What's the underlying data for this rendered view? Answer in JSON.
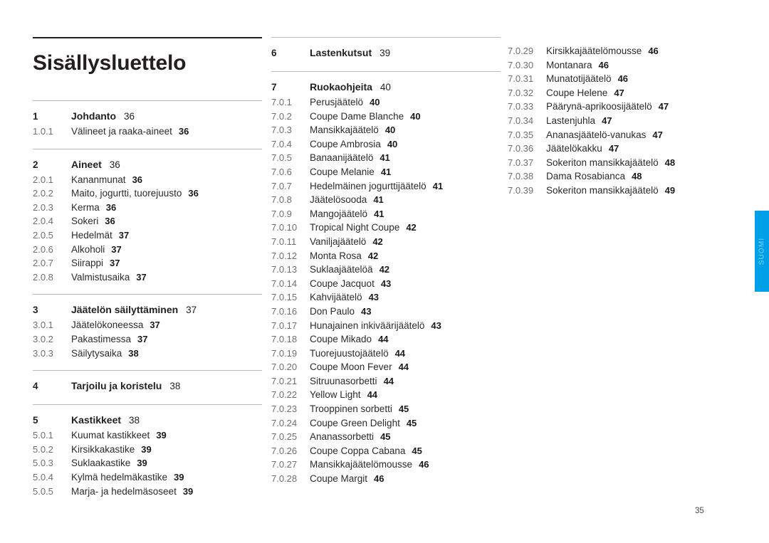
{
  "title": "Sisällysluettelo",
  "side_tab": {
    "label": "SUOMI",
    "color": "#00a0e9",
    "text_color": "#7fd2f6"
  },
  "folio": "35",
  "columns": [
    {
      "groups": [
        {
          "rule": "thick",
          "is_title_block": true,
          "entries": []
        },
        {
          "rule": "thin",
          "entries": [
            {
              "num": "1",
              "title": "Johdanto",
              "page": "36",
              "head": true
            },
            {
              "num": "1.0.1",
              "title": "Välineet ja raaka-aineet",
              "page": "36",
              "head": false
            }
          ]
        },
        {
          "rule": "thin",
          "entries": [
            {
              "num": "2",
              "title": "Aineet",
              "page": "36",
              "head": true
            },
            {
              "num": "2.0.1",
              "title": "Kananmunat",
              "page": "36",
              "head": false
            },
            {
              "num": "2.0.2",
              "title": "Maito, jogurtti, tuorejuusto",
              "page": "36",
              "head": false
            },
            {
              "num": "2.0.3",
              "title": "Kerma",
              "page": "36",
              "head": false
            },
            {
              "num": "2.0.4",
              "title": "Sokeri",
              "page": "36",
              "head": false
            },
            {
              "num": "2.0.5",
              "title": "Hedelmät",
              "page": "37",
              "head": false
            },
            {
              "num": "2.0.6",
              "title": "Alkoholi",
              "page": "37",
              "head": false
            },
            {
              "num": "2.0.7",
              "title": "Siirappi",
              "page": "37",
              "head": false
            },
            {
              "num": "2.0.8",
              "title": "Valmistusaika",
              "page": "37",
              "head": false
            }
          ]
        },
        {
          "rule": "thin",
          "entries": [
            {
              "num": "3",
              "title": "Jäätelön säilyttäminen",
              "page": "37",
              "head": true
            },
            {
              "num": "3.0.1",
              "title": "Jäätelökoneessa",
              "page": "37",
              "head": false
            },
            {
              "num": "3.0.2",
              "title": "Pakastimessa",
              "page": "37",
              "head": false
            },
            {
              "num": "3.0.3",
              "title": "Säilytysaika",
              "page": "38",
              "head": false
            }
          ]
        },
        {
          "rule": "thin",
          "entries": [
            {
              "num": "4",
              "title": "Tarjoilu ja koristelu",
              "page": "38",
              "head": true
            }
          ]
        },
        {
          "rule": "thin",
          "entries": [
            {
              "num": "5",
              "title": "Kastikkeet",
              "page": "38",
              "head": true
            },
            {
              "num": "5.0.1",
              "title": "Kuumat kastikkeet",
              "page": "39",
              "head": false
            },
            {
              "num": "5.0.2",
              "title": "Kirsikkakastike",
              "page": "39",
              "head": false
            },
            {
              "num": "5.0.3",
              "title": "Suklaakastike",
              "page": "39",
              "head": false
            },
            {
              "num": "5.0.4",
              "title": "Kylmä hedelmäkastike",
              "page": "39",
              "head": false
            },
            {
              "num": "5.0.5",
              "title": "Marja- ja hedelmäsoseet",
              "page": "39",
              "head": false
            }
          ]
        }
      ]
    },
    {
      "groups": [
        {
          "rule": "thin",
          "entries": [
            {
              "num": "6",
              "title": "Lastenkutsut",
              "page": "39",
              "head": true
            }
          ]
        },
        {
          "rule": "thin",
          "entries": [
            {
              "num": "7",
              "title": "Ruokaohjeita",
              "page": "40",
              "head": true
            },
            {
              "num": "7.0.1",
              "title": "Perusjäätelö",
              "page": "40",
              "head": false
            },
            {
              "num": "7.0.2",
              "title": "Coupe Dame Blanche",
              "page": "40",
              "head": false
            },
            {
              "num": "7.0.3",
              "title": "Mansikkajäätelö",
              "page": "40",
              "head": false
            },
            {
              "num": "7.0.4",
              "title": "Coupe Ambrosia",
              "page": "40",
              "head": false
            },
            {
              "num": "7.0.5",
              "title": "Banaanijäätelö",
              "page": "41",
              "head": false
            },
            {
              "num": "7.0.6",
              "title": "Coupe Melanie",
              "page": "41",
              "head": false
            },
            {
              "num": "7.0.7",
              "title": "Hedelmäinen jogurttijäätelö",
              "page": "41",
              "head": false
            },
            {
              "num": "7.0.8",
              "title": "Jäätelösooda",
              "page": "41",
              "head": false
            },
            {
              "num": "7.0.9",
              "title": "Mangojäätelö",
              "page": "41",
              "head": false
            },
            {
              "num": "7.0.10",
              "title": "Tropical Night Coupe",
              "page": "42",
              "head": false
            },
            {
              "num": "7.0.11",
              "title": "Vaniljajäätelö",
              "page": "42",
              "head": false
            },
            {
              "num": "7.0.12",
              "title": "Monta Rosa",
              "page": "42",
              "head": false
            },
            {
              "num": "7.0.13",
              "title": "Suklaajäätelöä",
              "page": "42",
              "head": false
            },
            {
              "num": "7.0.14",
              "title": "Coupe Jacquot",
              "page": "43",
              "head": false
            },
            {
              "num": "7.0.15",
              "title": "Kahvijäätelö",
              "page": "43",
              "head": false
            },
            {
              "num": "7.0.16",
              "title": "Don Paulo",
              "page": "43",
              "head": false
            },
            {
              "num": "7.0.17",
              "title": "Hunajainen inkivääri­jäätelö",
              "page": "43",
              "head": false
            },
            {
              "num": "7.0.18",
              "title": "Coupe Mikado",
              "page": "44",
              "head": false
            },
            {
              "num": "7.0.19",
              "title": "Tuorejuustojäätelö",
              "page": "44",
              "head": false
            },
            {
              "num": "7.0.20",
              "title": "Coupe Moon Fever",
              "page": "44",
              "head": false
            },
            {
              "num": "7.0.21",
              "title": "Sitruunasorbetti",
              "page": "44",
              "head": false
            },
            {
              "num": "7.0.22",
              "title": "Yellow Light",
              "page": "44",
              "head": false
            },
            {
              "num": "7.0.23",
              "title": "Trooppinen sorbetti",
              "page": "45",
              "head": false
            },
            {
              "num": "7.0.24",
              "title": "Coupe Green Delight",
              "page": "45",
              "head": false
            },
            {
              "num": "7.0.25",
              "title": "Ananassorbetti",
              "page": "45",
              "head": false
            },
            {
              "num": "7.0.26",
              "title": "Coupe Coppa Cabana",
              "page": "45",
              "head": false
            },
            {
              "num": "7.0.27",
              "title": "Mansikkajäätelömousse",
              "page": "46",
              "head": false
            },
            {
              "num": "7.0.28",
              "title": "Coupe Margit",
              "page": "46",
              "head": false
            }
          ]
        }
      ]
    },
    {
      "groups": [
        {
          "rule": "none",
          "entries": [
            {
              "num": "7.0.29",
              "title": "Kirsikkajäätelömousse",
              "page": "46",
              "head": false
            },
            {
              "num": "7.0.30",
              "title": "Montanara",
              "page": "46",
              "head": false
            },
            {
              "num": "7.0.31",
              "title": "Munatotijäätelö",
              "page": "46",
              "head": false
            },
            {
              "num": "7.0.32",
              "title": "Coupe Helene",
              "page": "47",
              "head": false
            },
            {
              "num": "7.0.33",
              "title": "Päärynä-aprikoosijäätelö",
              "page": "47",
              "head": false
            },
            {
              "num": "7.0.34",
              "title": "Lastenjuhla",
              "page": "47",
              "head": false
            },
            {
              "num": "7.0.35",
              "title": "Ananasjäätelö-vanukas",
              "page": "47",
              "head": false
            },
            {
              "num": "7.0.36",
              "title": "Jäätelökakku",
              "page": "47",
              "head": false
            },
            {
              "num": "7.0.37",
              "title": "Sokeriton mansikkajäätelö",
              "page": "48",
              "head": false
            },
            {
              "num": "7.0.38",
              "title": "Dama Rosabianca",
              "page": "48",
              "head": false
            },
            {
              "num": "7.0.39",
              "title": "Sokeriton mansikkajäätelö",
              "page": "49",
              "head": false
            }
          ]
        }
      ]
    }
  ]
}
